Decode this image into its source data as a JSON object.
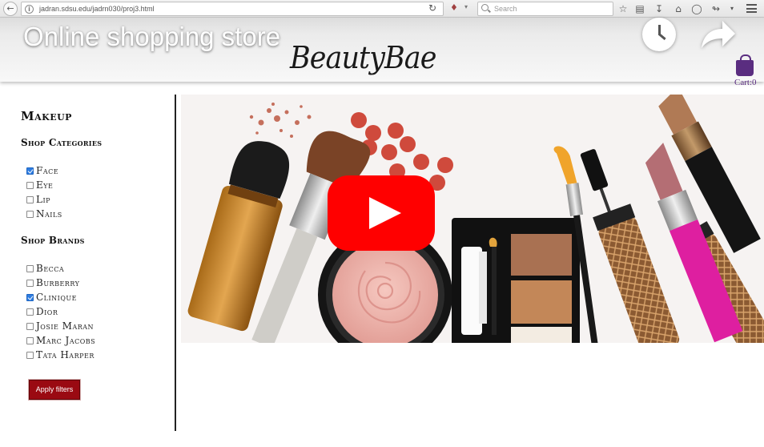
{
  "browser": {
    "url": "jadran.sdsu.edu/jadrn030/proj3.html",
    "search_placeholder": "Search"
  },
  "video": {
    "title": "Online shopping store"
  },
  "site": {
    "logo_text": "BeautyBae",
    "cart_label": "Cart:0"
  },
  "sidebar": {
    "heading": "Makeup",
    "categories_heading": "Shop Categories",
    "categories": [
      {
        "label": "Face",
        "checked": true
      },
      {
        "label": "Eye",
        "checked": false
      },
      {
        "label": "Lip",
        "checked": false
      },
      {
        "label": "Nails",
        "checked": false
      }
    ],
    "brands_heading": "Shop Brands",
    "brands": [
      {
        "label": "Becca",
        "checked": false
      },
      {
        "label": "Burberry",
        "checked": false
      },
      {
        "label": "Clinique",
        "checked": true
      },
      {
        "label": "Dior",
        "checked": false
      },
      {
        "label": "Josie Maran",
        "checked": false
      },
      {
        "label": "Marc Jacobs",
        "checked": false
      },
      {
        "label": "Tata Harper",
        "checked": false
      }
    ],
    "apply_label": "Apply filters"
  },
  "colors": {
    "brand_purple": "#5a2d80",
    "apply_red": "#9a0a12",
    "checkbox_blue": "#2f7de1",
    "youtube_red": "#ff0000"
  }
}
